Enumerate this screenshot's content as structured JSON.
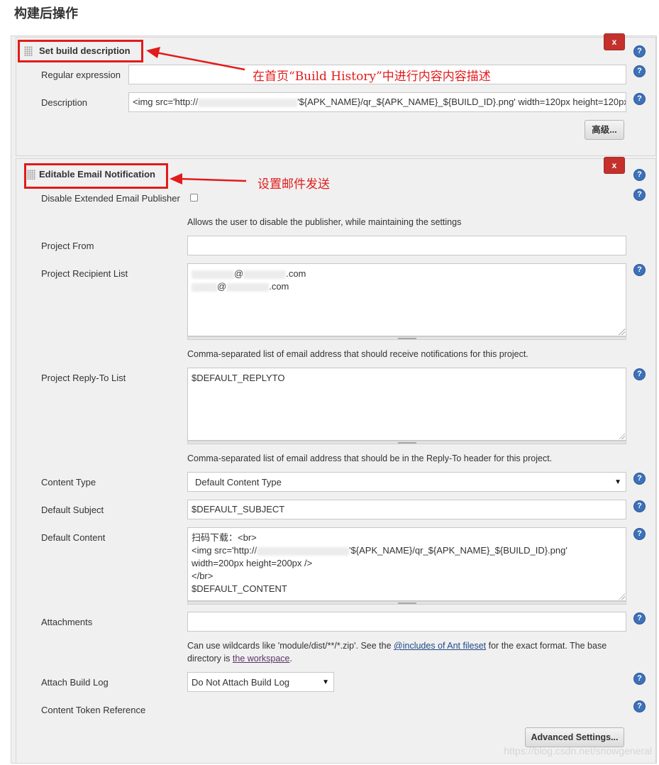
{
  "page": {
    "heading": "构建后操作"
  },
  "build_description": {
    "title": "Set build description",
    "regex_label": "Regular expression",
    "regex_value": "",
    "description_label": "Description",
    "description_prefix": "<img src='http://",
    "description_suffix": "'${APK_NAME}/qr_${APK_NAME}_${BUILD_ID}.png' width=120px height=120px",
    "advanced_label": "高级...",
    "delete_label": "x"
  },
  "email": {
    "title": "Editable Email Notification",
    "delete_label": "x",
    "disable_label": "Disable Extended Email Publisher",
    "disable_hint": "Allows the user to disable the publisher, while maintaining the settings",
    "project_from_label": "Project From",
    "project_from_value": "",
    "recipient_label": "Project Recipient List",
    "recipient_line1": "@",
    "recipient_line1_suffix": ".com",
    "recipient_line2": "@",
    "recipient_line2_suffix": ".com",
    "recipient_hint": "Comma-separated list of email address that should receive notifications for this project.",
    "replyto_label": "Project Reply-To List",
    "replyto_value": "$DEFAULT_REPLYTO",
    "replyto_hint": "Comma-separated list of email address that should be in the Reply-To header for this project.",
    "content_type_label": "Content Type",
    "content_type_value": "Default Content Type",
    "subject_label": "Default Subject",
    "subject_value": "$DEFAULT_SUBJECT",
    "content_label": "Default Content",
    "content_line1": "扫码下载：<br>",
    "content_line2_prefix": "<img src='http://",
    "content_line2_suffix": "'${APK_NAME}/qr_${APK_NAME}_${BUILD_ID}.png'",
    "content_line3": "width=200px height=200px />",
    "content_line4": "</br>",
    "content_line5": "$DEFAULT_CONTENT",
    "attachments_label": "Attachments",
    "attachments_value": "",
    "attachments_hint_1": "Can use wildcards like 'module/dist/**/*.zip'. See the ",
    "attachments_link_1": "@includes of Ant fileset",
    "attachments_hint_2": " for the exact format. The base directory is ",
    "attachments_link_2": "the workspace",
    "attachments_hint_3": ".",
    "build_log_label": "Attach Build Log",
    "build_log_value": "Do Not Attach Build Log",
    "token_label": "Content Token Reference",
    "advanced_settings_label": "Advanced Settings..."
  },
  "annotations": {
    "build_history_note": "在首页“Build History”中进行内容内容描述",
    "email_note": "设置邮件发送"
  },
  "watermark": "https://blog.csdn.net/snowgeneral",
  "colors": {
    "annotation_red": "#e21b1b",
    "delete_red": "#c4302b",
    "help_blue": "#3d71b8",
    "panel_bg": "#f0f0f0"
  }
}
